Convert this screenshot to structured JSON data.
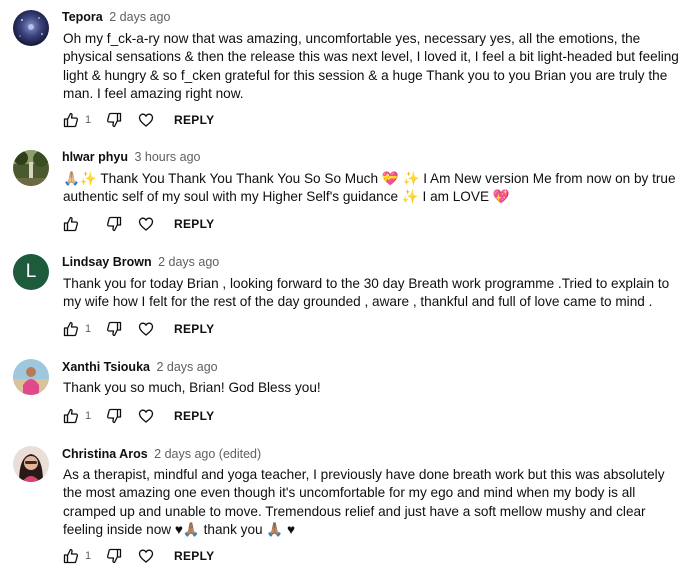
{
  "reply_label": "REPLY",
  "comments": [
    {
      "author": "Tepora",
      "time": "2 days ago",
      "text": "Oh my f_ck-a-ry now that was amazing, uncomfortable yes, necessary yes, all the emotions, the physical sensations & then the release this was next level, I loved it, I feel a bit light-headed but feeling light & hungry & so f_cken grateful for this session & a huge Thank you to you Brian you are truly the man. I feel amazing right now.",
      "likes": "1",
      "avatar": "galaxy-image"
    },
    {
      "author": "hlwar phyu",
      "time": "3 hours ago",
      "text": "🙏🏼✨ Thank You Thank You Thank You So So Much 💝 ✨  I Am New version Me from now on by true authentic self of my soul with my Higher Self's guidance ✨ I am LOVE 💖",
      "likes": "",
      "avatar": "forest-photo"
    },
    {
      "author": "Lindsay Brown",
      "time": "2 days ago",
      "text": "Thank you for today Brian , looking forward to the 30 day Breath work programme .Tried  to explain to my wife how I felt for the rest of the day grounded , aware , thankful and full of love came to mind .",
      "likes": "1",
      "avatar_letter": "L",
      "avatar_color": "#1e5a3c"
    },
    {
      "author": "Xanthi Tsiouka",
      "time": "2 days ago",
      "text": "Thank you so much, Brian! God Bless you!",
      "likes": "1",
      "avatar": "beach-photo"
    },
    {
      "author": "Christina Aros",
      "time": "2 days ago (edited)",
      "text": "As a therapist, mindful and yoga teacher, I previously have done breath work but this was absolutely the most amazing one even though it's uncomfortable for my ego and mind when my body is all cramped up and unable to move. Tremendous relief and just have a soft mellow mushy and clear feeling inside now ♥🙏🏽 thank you 🙏🏽 ♥",
      "likes": "1",
      "avatar": "portrait-photo"
    }
  ]
}
